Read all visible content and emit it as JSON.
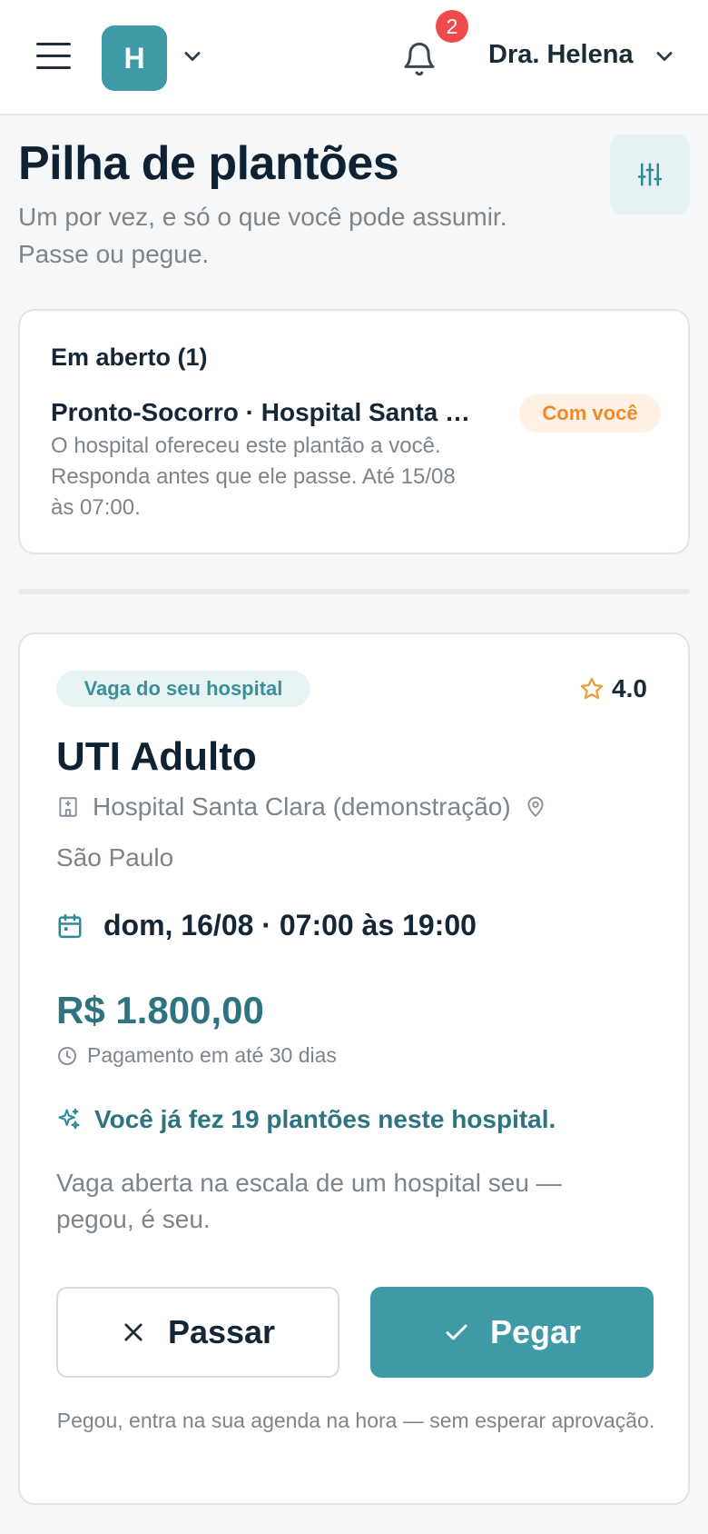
{
  "header": {
    "org_initial": "H",
    "notifications_count": "2",
    "user_name": "Dra. Helena"
  },
  "page": {
    "title": "Pilha de plantões",
    "subtitle": "Um por vez, e só o que você pode assumir. Passe ou pegue."
  },
  "open_section": {
    "title": "Em aberto (1)",
    "item_title": "Pronto-Socorro · Hospital Santa Clara (demonstração)",
    "item_status": "Com você",
    "item_description": "O hospital ofereceu este plantão a você. Responda antes que ele passe. Até 15/08 às 07:00."
  },
  "shift_card": {
    "tag": "Vaga do seu hospital",
    "rating": "4.0",
    "title": "UTI Adulto",
    "hospital": "Hospital Santa Clara (demonstração)",
    "city": "São Paulo",
    "datetime": "dom, 16/08 · 07:00 às 19:00",
    "price": "R$ 1.800,00",
    "payment_terms": "Pagamento em até 30 dias",
    "history": "Você já fez 19 plantões neste hospital.",
    "note": "Vaga aberta na escala de um hospital seu — pegou, é seu.",
    "pass_label": "Passar",
    "take_label": "Pegar",
    "footnote": "Pegou, entra na sua agenda na hora — sem esperar aprovação."
  },
  "colors": {
    "accent": "#3f9aa8",
    "accent_dark": "#2e7480",
    "warning": "#ee8a2c",
    "badge_red": "#ef4b4b"
  },
  "icons": [
    "menu-icon",
    "chevron-down-icon",
    "bell-icon",
    "sliders-icon",
    "star-icon",
    "hospital-icon",
    "map-pin-icon",
    "calendar-icon",
    "clock-icon",
    "sparkles-icon",
    "close-icon",
    "check-icon"
  ]
}
